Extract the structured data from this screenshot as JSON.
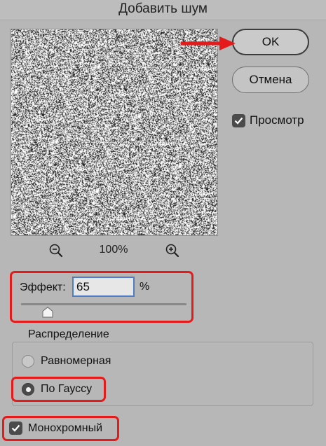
{
  "window": {
    "title": "Добавить шум"
  },
  "preview": {
    "zoom_level": "100%",
    "zoom_out_icon": "zoom-out-icon",
    "zoom_in_icon": "zoom-in-icon",
    "noise_fill": 0.5
  },
  "buttons": {
    "ok_label": "OK",
    "cancel_label": "Отмена"
  },
  "preview_toggle": {
    "label": "Просмотр",
    "checked": true
  },
  "effect": {
    "label": "Эффект:",
    "value": "65",
    "unit": "%",
    "slider_position": 0.16
  },
  "distribution": {
    "title": "Распределение",
    "options": [
      {
        "label": "Равномерная",
        "selected": false
      },
      {
        "label": "По Гауссу",
        "selected": true
      }
    ]
  },
  "monochrome": {
    "label": "Монохромный",
    "checked": true
  },
  "colors": {
    "highlight": "#e51b1b",
    "arrow": "#e51b1b",
    "input_border": "#4f7cc4",
    "background": "#b7b7b7"
  }
}
